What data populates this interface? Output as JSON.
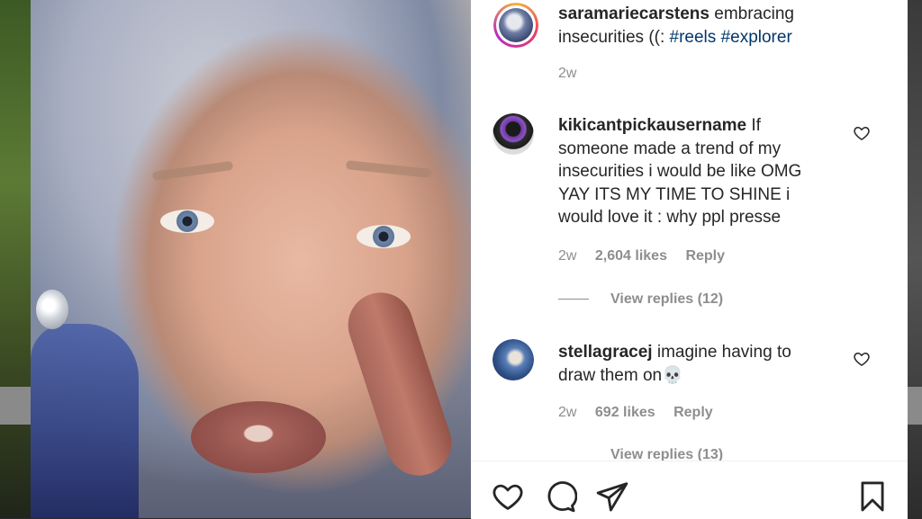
{
  "post": {
    "username": "saramariecarstens",
    "caption": "embracing insecurities ((: ",
    "hashtags": [
      "#reels",
      "#explorer"
    ],
    "time": "2w"
  },
  "comments": [
    {
      "username": "kikicantpickausername",
      "text": "If someone made a trend of my insecurities i would be like OMG YAY ITS MY TIME TO SHINE i would love it : why ppl presse",
      "time": "2w",
      "likes": "2,604 likes",
      "reply": "Reply",
      "view_replies": "View replies (12)"
    },
    {
      "username": "stellagracej",
      "text": "imagine having to draw them on",
      "emoji": "💀",
      "time": "2w",
      "likes": "692 likes",
      "reply": "Reply",
      "view_replies": "View replies (13)"
    }
  ],
  "actions": {
    "icons": [
      "heart-icon",
      "comment-icon",
      "share-icon",
      "bookmark-icon"
    ]
  },
  "colors": {
    "text": "#262626",
    "muted": "#8e8e8e",
    "hashtag": "#00376b"
  }
}
